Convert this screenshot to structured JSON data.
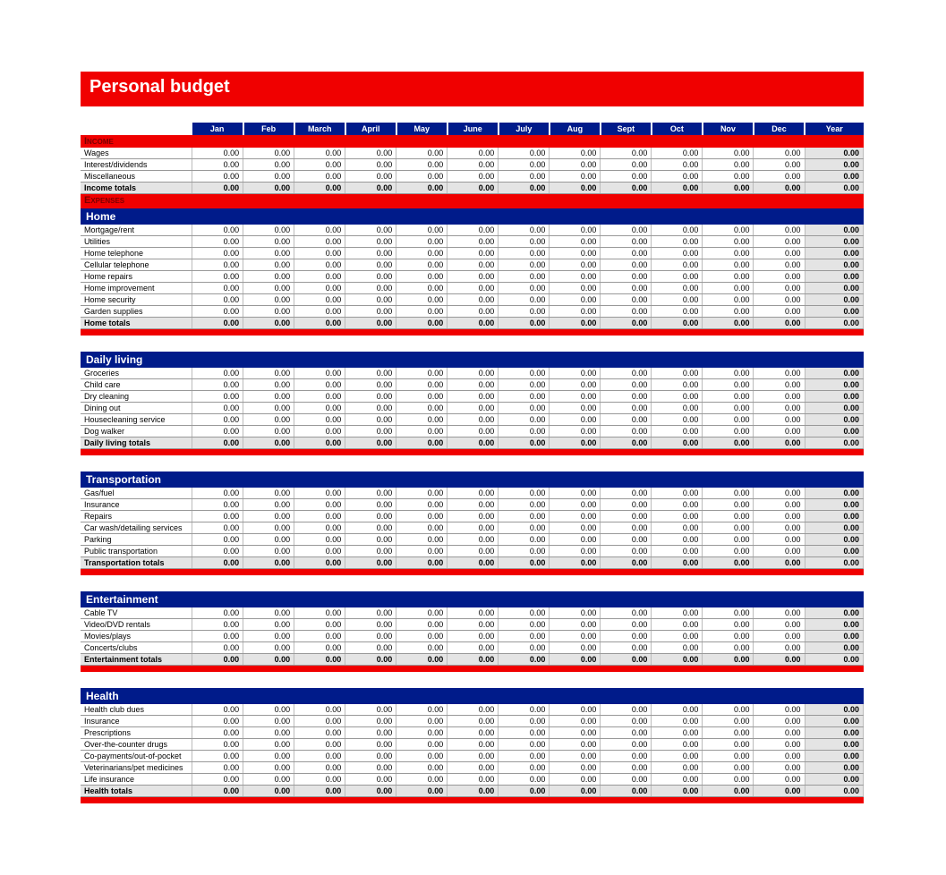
{
  "title": "Personal budget",
  "months": [
    "Jan",
    "Feb",
    "March",
    "April",
    "May",
    "June",
    "July",
    "Aug",
    "Sept",
    "Oct",
    "Nov",
    "Dec",
    "Year"
  ],
  "zero": "0.00",
  "incomeHdr": "Income",
  "expensesHdr": "Expenses",
  "income": {
    "rows": [
      "Wages",
      "Interest/dividends",
      "Miscellaneous"
    ],
    "total": "Income totals"
  },
  "categories": [
    {
      "name": "Home",
      "rows": [
        "Mortgage/rent",
        "Utilities",
        "Home telephone",
        "Cellular telephone",
        "Home repairs",
        "Home improvement",
        "Home security",
        "Garden supplies"
      ],
      "total": "Home totals"
    },
    {
      "name": "Daily living",
      "rows": [
        "Groceries",
        "Child care",
        "Dry cleaning",
        "Dining out",
        "Housecleaning service",
        "Dog walker"
      ],
      "total": "Daily living totals"
    },
    {
      "name": "Transportation",
      "rows": [
        "Gas/fuel",
        "Insurance",
        "Repairs",
        "Car wash/detailing services",
        "Parking",
        "Public transportation"
      ],
      "total": "Transportation totals"
    },
    {
      "name": "Entertainment",
      "rows": [
        "Cable TV",
        "Video/DVD rentals",
        "Movies/plays",
        "Concerts/clubs"
      ],
      "total": "Entertainment totals"
    },
    {
      "name": "Health",
      "rows": [
        "Health club dues",
        "Insurance",
        "Prescriptions",
        "Over-the-counter drugs",
        "Co-payments/out-of-pocket",
        "Veterinarians/pet medicines",
        "Life insurance"
      ],
      "total": "Health totals"
    }
  ],
  "chart_data": {
    "type": "table",
    "title": "Personal budget",
    "columns": [
      "Jan",
      "Feb",
      "March",
      "April",
      "May",
      "June",
      "July",
      "Aug",
      "Sept",
      "Oct",
      "Nov",
      "Dec",
      "Year"
    ],
    "sections": [
      {
        "name": "Income",
        "rows": [
          {
            "label": "Wages",
            "values": [
              0,
              0,
              0,
              0,
              0,
              0,
              0,
              0,
              0,
              0,
              0,
              0,
              0
            ]
          },
          {
            "label": "Interest/dividends",
            "values": [
              0,
              0,
              0,
              0,
              0,
              0,
              0,
              0,
              0,
              0,
              0,
              0,
              0
            ]
          },
          {
            "label": "Miscellaneous",
            "values": [
              0,
              0,
              0,
              0,
              0,
              0,
              0,
              0,
              0,
              0,
              0,
              0,
              0
            ]
          },
          {
            "label": "Income totals",
            "values": [
              0,
              0,
              0,
              0,
              0,
              0,
              0,
              0,
              0,
              0,
              0,
              0,
              0
            ]
          }
        ]
      },
      {
        "name": "Home",
        "rows": [
          {
            "label": "Mortgage/rent",
            "values": [
              0,
              0,
              0,
              0,
              0,
              0,
              0,
              0,
              0,
              0,
              0,
              0,
              0
            ]
          },
          {
            "label": "Utilities",
            "values": [
              0,
              0,
              0,
              0,
              0,
              0,
              0,
              0,
              0,
              0,
              0,
              0,
              0
            ]
          },
          {
            "label": "Home telephone",
            "values": [
              0,
              0,
              0,
              0,
              0,
              0,
              0,
              0,
              0,
              0,
              0,
              0,
              0
            ]
          },
          {
            "label": "Cellular telephone",
            "values": [
              0,
              0,
              0,
              0,
              0,
              0,
              0,
              0,
              0,
              0,
              0,
              0,
              0
            ]
          },
          {
            "label": "Home repairs",
            "values": [
              0,
              0,
              0,
              0,
              0,
              0,
              0,
              0,
              0,
              0,
              0,
              0,
              0
            ]
          },
          {
            "label": "Home improvement",
            "values": [
              0,
              0,
              0,
              0,
              0,
              0,
              0,
              0,
              0,
              0,
              0,
              0,
              0
            ]
          },
          {
            "label": "Home security",
            "values": [
              0,
              0,
              0,
              0,
              0,
              0,
              0,
              0,
              0,
              0,
              0,
              0,
              0
            ]
          },
          {
            "label": "Garden supplies",
            "values": [
              0,
              0,
              0,
              0,
              0,
              0,
              0,
              0,
              0,
              0,
              0,
              0,
              0
            ]
          },
          {
            "label": "Home totals",
            "values": [
              0,
              0,
              0,
              0,
              0,
              0,
              0,
              0,
              0,
              0,
              0,
              0,
              0
            ]
          }
        ]
      },
      {
        "name": "Daily living",
        "rows": [
          {
            "label": "Groceries",
            "values": [
              0,
              0,
              0,
              0,
              0,
              0,
              0,
              0,
              0,
              0,
              0,
              0,
              0
            ]
          },
          {
            "label": "Child care",
            "values": [
              0,
              0,
              0,
              0,
              0,
              0,
              0,
              0,
              0,
              0,
              0,
              0,
              0
            ]
          },
          {
            "label": "Dry cleaning",
            "values": [
              0,
              0,
              0,
              0,
              0,
              0,
              0,
              0,
              0,
              0,
              0,
              0,
              0
            ]
          },
          {
            "label": "Dining out",
            "values": [
              0,
              0,
              0,
              0,
              0,
              0,
              0,
              0,
              0,
              0,
              0,
              0,
              0
            ]
          },
          {
            "label": "Housecleaning service",
            "values": [
              0,
              0,
              0,
              0,
              0,
              0,
              0,
              0,
              0,
              0,
              0,
              0,
              0
            ]
          },
          {
            "label": "Dog walker",
            "values": [
              0,
              0,
              0,
              0,
              0,
              0,
              0,
              0,
              0,
              0,
              0,
              0,
              0
            ]
          },
          {
            "label": "Daily living totals",
            "values": [
              0,
              0,
              0,
              0,
              0,
              0,
              0,
              0,
              0,
              0,
              0,
              0,
              0
            ]
          }
        ]
      },
      {
        "name": "Transportation",
        "rows": [
          {
            "label": "Gas/fuel",
            "values": [
              0,
              0,
              0,
              0,
              0,
              0,
              0,
              0,
              0,
              0,
              0,
              0,
              0
            ]
          },
          {
            "label": "Insurance",
            "values": [
              0,
              0,
              0,
              0,
              0,
              0,
              0,
              0,
              0,
              0,
              0,
              0,
              0
            ]
          },
          {
            "label": "Repairs",
            "values": [
              0,
              0,
              0,
              0,
              0,
              0,
              0,
              0,
              0,
              0,
              0,
              0,
              0
            ]
          },
          {
            "label": "Car wash/detailing services",
            "values": [
              0,
              0,
              0,
              0,
              0,
              0,
              0,
              0,
              0,
              0,
              0,
              0,
              0
            ]
          },
          {
            "label": "Parking",
            "values": [
              0,
              0,
              0,
              0,
              0,
              0,
              0,
              0,
              0,
              0,
              0,
              0,
              0
            ]
          },
          {
            "label": "Public transportation",
            "values": [
              0,
              0,
              0,
              0,
              0,
              0,
              0,
              0,
              0,
              0,
              0,
              0,
              0
            ]
          },
          {
            "label": "Transportation totals",
            "values": [
              0,
              0,
              0,
              0,
              0,
              0,
              0,
              0,
              0,
              0,
              0,
              0,
              0
            ]
          }
        ]
      },
      {
        "name": "Entertainment",
        "rows": [
          {
            "label": "Cable TV",
            "values": [
              0,
              0,
              0,
              0,
              0,
              0,
              0,
              0,
              0,
              0,
              0,
              0,
              0
            ]
          },
          {
            "label": "Video/DVD rentals",
            "values": [
              0,
              0,
              0,
              0,
              0,
              0,
              0,
              0,
              0,
              0,
              0,
              0,
              0
            ]
          },
          {
            "label": "Movies/plays",
            "values": [
              0,
              0,
              0,
              0,
              0,
              0,
              0,
              0,
              0,
              0,
              0,
              0,
              0
            ]
          },
          {
            "label": "Concerts/clubs",
            "values": [
              0,
              0,
              0,
              0,
              0,
              0,
              0,
              0,
              0,
              0,
              0,
              0,
              0
            ]
          },
          {
            "label": "Entertainment totals",
            "values": [
              0,
              0,
              0,
              0,
              0,
              0,
              0,
              0,
              0,
              0,
              0,
              0,
              0
            ]
          }
        ]
      },
      {
        "name": "Health",
        "rows": [
          {
            "label": "Health club dues",
            "values": [
              0,
              0,
              0,
              0,
              0,
              0,
              0,
              0,
              0,
              0,
              0,
              0,
              0
            ]
          },
          {
            "label": "Insurance",
            "values": [
              0,
              0,
              0,
              0,
              0,
              0,
              0,
              0,
              0,
              0,
              0,
              0,
              0
            ]
          },
          {
            "label": "Prescriptions",
            "values": [
              0,
              0,
              0,
              0,
              0,
              0,
              0,
              0,
              0,
              0,
              0,
              0,
              0
            ]
          },
          {
            "label": "Over-the-counter drugs",
            "values": [
              0,
              0,
              0,
              0,
              0,
              0,
              0,
              0,
              0,
              0,
              0,
              0,
              0
            ]
          },
          {
            "label": "Co-payments/out-of-pocket",
            "values": [
              0,
              0,
              0,
              0,
              0,
              0,
              0,
              0,
              0,
              0,
              0,
              0,
              0
            ]
          },
          {
            "label": "Veterinarians/pet medicines",
            "values": [
              0,
              0,
              0,
              0,
              0,
              0,
              0,
              0,
              0,
              0,
              0,
              0,
              0
            ]
          },
          {
            "label": "Life insurance",
            "values": [
              0,
              0,
              0,
              0,
              0,
              0,
              0,
              0,
              0,
              0,
              0,
              0,
              0
            ]
          },
          {
            "label": "Health totals",
            "values": [
              0,
              0,
              0,
              0,
              0,
              0,
              0,
              0,
              0,
              0,
              0,
              0,
              0
            ]
          }
        ]
      }
    ]
  }
}
